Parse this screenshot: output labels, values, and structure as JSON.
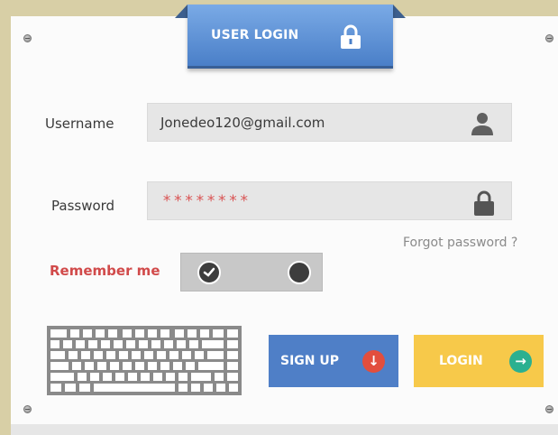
{
  "header": {
    "title": "USER LOGIN",
    "icon": "lock-icon"
  },
  "username": {
    "label": "Username",
    "value": "Jonedeo120@gmail.com",
    "icon": "user-icon"
  },
  "password": {
    "label": "Password",
    "value": "********",
    "icon": "lock-icon"
  },
  "forgot_password": "Forgot password ?",
  "remember": {
    "label": "Remember me",
    "checked": true
  },
  "buttons": {
    "signup": {
      "label": "SIGN UP",
      "icon": "arrow-down-icon",
      "color": "#4f7fc7"
    },
    "login": {
      "label": "LOGIN",
      "icon": "arrow-right-icon",
      "color": "#f7c94a"
    }
  },
  "colors": {
    "accent_red": "#d14a4a",
    "background": "#d8cfa6"
  }
}
